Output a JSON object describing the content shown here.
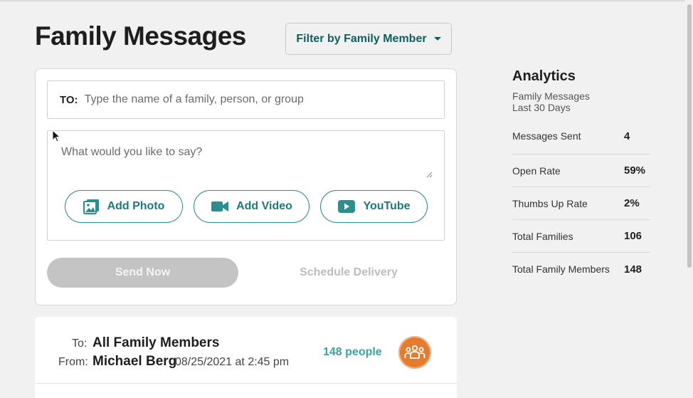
{
  "page": {
    "title": "Family Messages"
  },
  "filter": {
    "label": "Filter by Family Member"
  },
  "composer": {
    "to_label": "TO:",
    "to_placeholder": "Type the name of a family, person, or group",
    "message_placeholder": "What would you like to say?",
    "add_photo": "Add Photo",
    "add_video": "Add Video",
    "youtube": "YouTube",
    "send_now": "Send Now",
    "schedule": "Schedule Delivery"
  },
  "message": {
    "to_label": "To:",
    "from_label": "From:",
    "recipient": "All Family Members",
    "sender": "Michael Berg",
    "sent_at": "08/25/2021 at 2:45 pm",
    "people": "148 people"
  },
  "analytics": {
    "title": "Analytics",
    "subtitle_line1": "Family Messages",
    "subtitle_line2": "Last 30 Days",
    "rows": [
      {
        "label": "Messages Sent",
        "value": "4"
      },
      {
        "label": "Open Rate",
        "value": "59%"
      },
      {
        "label": "Thumbs Up Rate",
        "value": "2%"
      },
      {
        "label": "Total Families",
        "value": "106"
      },
      {
        "label": "Total Family Members",
        "value": "148"
      }
    ]
  },
  "colors": {
    "accent": "#1d7b79",
    "avatar": "#e47b2d",
    "disabled": "#c4c4c4"
  }
}
